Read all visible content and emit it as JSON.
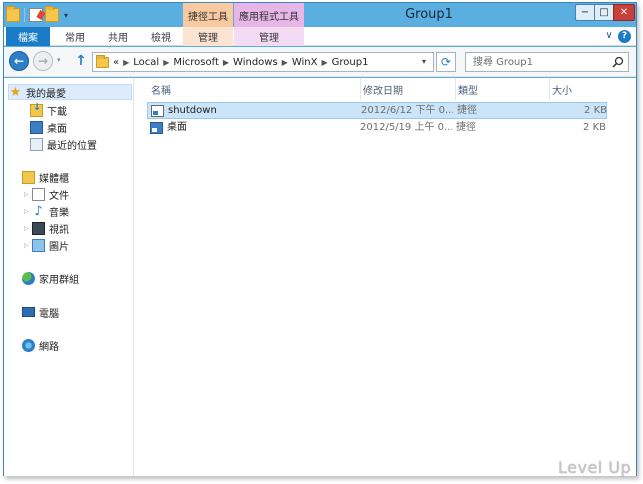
{
  "window": {
    "title": "Group1",
    "contextual_tabs": [
      "捷徑工具",
      "應用程式工具"
    ],
    "controls": {
      "minimize": "−",
      "maximize": "□",
      "close": "✕"
    }
  },
  "quick_access": {
    "dropdown": "▾"
  },
  "ribbon": {
    "tabs": [
      "檔案",
      "常用",
      "共用",
      "檢視",
      "管理",
      "管理"
    ],
    "expand": "∨",
    "help": "?"
  },
  "navigation": {
    "back": "←",
    "forward": "→",
    "recent": "▾",
    "up": "↑",
    "breadcrumb_prefix": "«",
    "breadcrumbs": [
      "Local",
      "Microsoft",
      "Windows",
      "WinX",
      "Group1"
    ],
    "address_dropdown": "▾",
    "refresh": "⟳",
    "search_placeholder": "搜尋 Group1"
  },
  "sidebar": {
    "favorites": {
      "label": "我的最愛",
      "items": [
        "下載",
        "桌面",
        "最近的位置"
      ]
    },
    "libraries": {
      "label": "媒體櫃",
      "items": [
        "文件",
        "音樂",
        "視訊",
        "圖片"
      ]
    },
    "homegroup": "家用群組",
    "computer": "電腦",
    "network": "網路"
  },
  "file_list": {
    "columns": [
      "名稱",
      "修改日期",
      "類型",
      "大小"
    ],
    "rows": [
      {
        "name": "shutdown",
        "date": "2012/6/12 下午 0...",
        "type": "捷徑",
        "size": "2 KB",
        "selected": true
      },
      {
        "name": "桌面",
        "date": "2012/5/19 上午 0...",
        "type": "捷徑",
        "size": "2 KB",
        "selected": false
      }
    ]
  },
  "watermark": "Level Up",
  "colors": {
    "accent": "#1a7cc6",
    "titlebar": "#5aaee0",
    "selection": "#cce4f7"
  }
}
